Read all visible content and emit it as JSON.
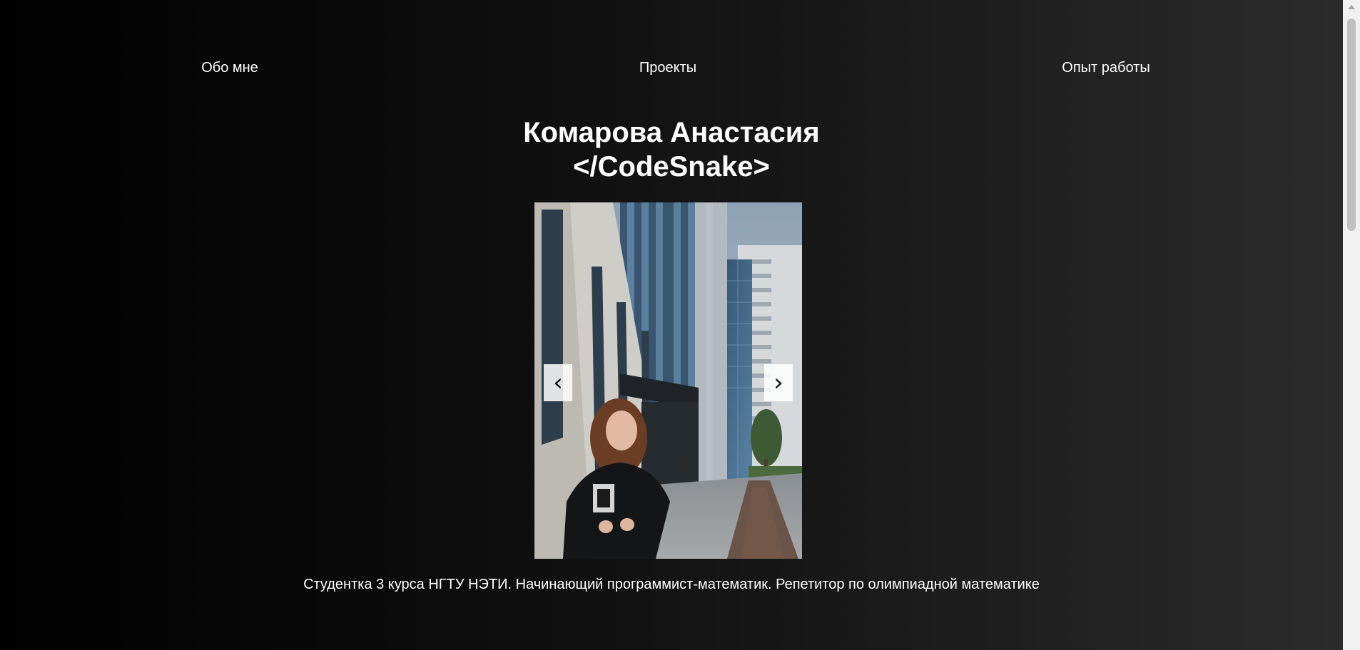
{
  "nav": {
    "items": [
      {
        "label": "Обо мне"
      },
      {
        "label": "Проекты"
      },
      {
        "label": "Опыт работы"
      }
    ]
  },
  "hero": {
    "name": "Комарова Анастасия",
    "nickname": "</CodeSnake>"
  },
  "carousel": {
    "prev_symbol": "‹",
    "next_symbol": "›"
  },
  "bio": {
    "text": "Студентка 3 курса НГТУ НЭТИ. Начинающий программист-математик. Репетитор по олимпиадной математике"
  }
}
